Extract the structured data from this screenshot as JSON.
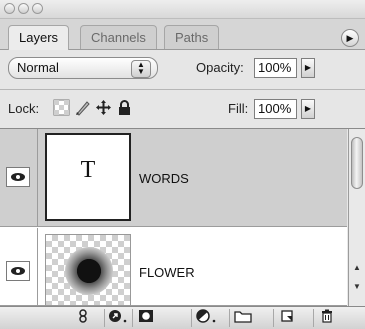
{
  "tabs": [
    {
      "label": "Layers",
      "active": true
    },
    {
      "label": "Channels",
      "active": false
    },
    {
      "label": "Paths",
      "active": false
    }
  ],
  "blend_mode": {
    "value": "Normal"
  },
  "opacity": {
    "label": "Opacity:",
    "value": "100%"
  },
  "lock": {
    "label": "Lock:",
    "icons": [
      "transparent-pixels-lock-icon",
      "brush-lock-icon",
      "move-lock-icon",
      "padlock-icon"
    ]
  },
  "fill": {
    "label": "Fill:",
    "value": "100%"
  },
  "layers": [
    {
      "name": "WORDS",
      "type": "text",
      "thumb_glyph": "T",
      "selected": true,
      "visible": true
    },
    {
      "name": "FLOWER",
      "type": "image",
      "selected": false,
      "visible": true
    }
  ],
  "bottom_bar": {
    "icons": [
      "link-icon",
      "layer-style-icon",
      "layer-mask-icon",
      "adjustment-layer-icon",
      "new-group-icon",
      "new-layer-icon",
      "trash-icon"
    ]
  },
  "colors": {
    "selected_row": "#cfcfcf",
    "panel_bg": "#e6e6e6"
  }
}
